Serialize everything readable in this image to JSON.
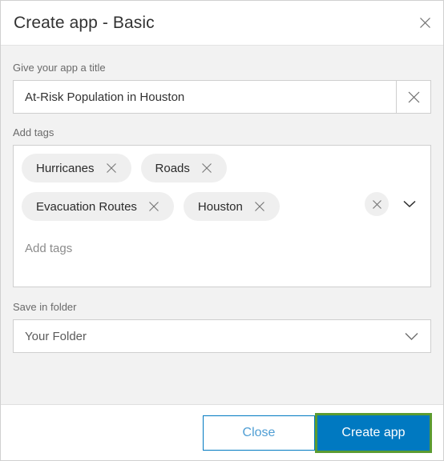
{
  "dialog": {
    "title": "Create app - Basic",
    "close_icon": "close-x-icon"
  },
  "form": {
    "title_field": {
      "label": "Give your app a title",
      "value": "At-Risk Population in Houston",
      "placeholder": "",
      "clear_icon": "close-x-icon"
    },
    "tags_field": {
      "label": "Add tags",
      "placeholder": "Add tags",
      "value": "",
      "tags": [
        {
          "label": "Hurricanes",
          "remove_icon": "close-x-icon"
        },
        {
          "label": "Roads",
          "remove_icon": "close-x-icon"
        },
        {
          "label": "Evacuation Routes",
          "remove_icon": "close-x-icon"
        },
        {
          "label": "Houston",
          "remove_icon": "close-x-icon"
        }
      ],
      "clear_all_icon": "close-x-icon",
      "expand_icon": "chevron-down-icon"
    },
    "folder_field": {
      "label": "Save in folder",
      "value": "Your Folder",
      "chevron_icon": "chevron-down-icon"
    }
  },
  "footer": {
    "close_label": "Close",
    "create_label": "Create app"
  },
  "colors": {
    "accent_blue": "#0079c1",
    "highlight_green": "#5b9b31",
    "body_background": "#f2f2f2",
    "panel_white": "#ffffff",
    "tag_pill": "#efefef",
    "border_gray": "#cfcfcf",
    "text_dark": "#323232",
    "text_muted": "#6a6a6a"
  }
}
